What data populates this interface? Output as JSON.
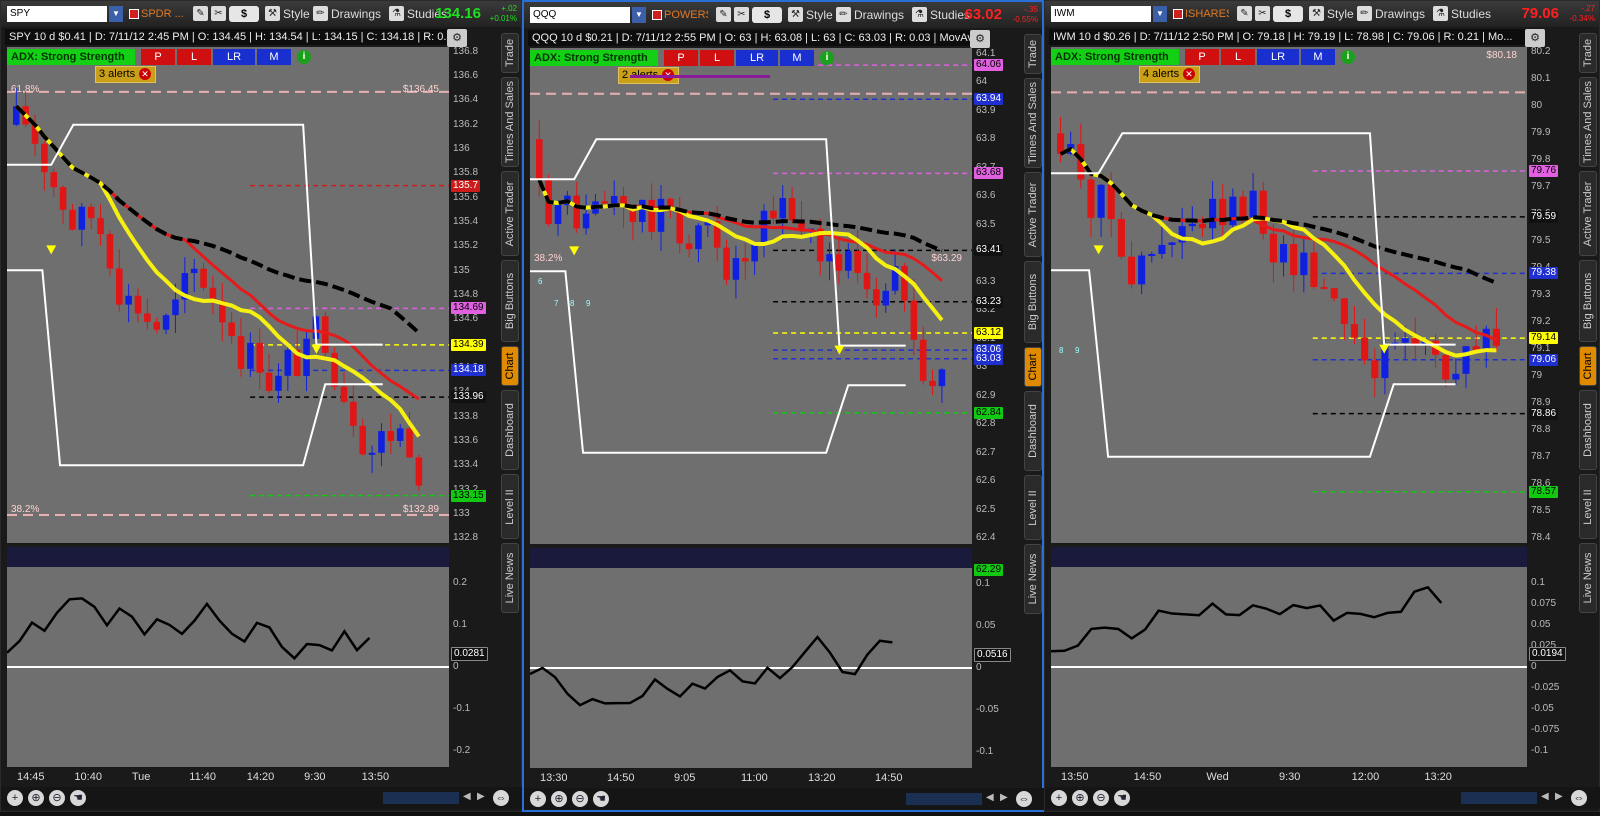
{
  "panels": [
    {
      "id": "spy",
      "symbol": "SPY",
      "description": "SPDR ...",
      "last": "134.16",
      "last_color": "#1fe01f",
      "change_top": "+.02",
      "change_bottom": "+0.01%",
      "change_color": "#1fe01f",
      "info": "SPY 10 d $0.41 | D: 7/11/12 2:45 PM | O: 134.45 | H: 134.54 | L: 134.15 | C: 134.18 | R: 0.39",
      "adx": "ADX: Strong Strength",
      "alerts": "3 alerts",
      "fib_top": "61.8%",
      "fib_bottom": "38.2%",
      "level_top": "$136.45",
      "level_bottom": "$132.89",
      "price_axis": [
        "136.8",
        "136.6",
        "136.4",
        "136.2",
        "136",
        "135.8",
        "135.6",
        "135.4",
        "135.2",
        "135",
        "134.8",
        "134.6",
        "134.4",
        "134.2",
        "134",
        "133.8",
        "133.6",
        "133.4",
        "133.2",
        "133",
        "132.8"
      ],
      "badges": [
        {
          "text": "135.7",
          "bg": "#cc1b1b",
          "fg": "#fff",
          "value": 135.7
        },
        {
          "text": "134.69",
          "bg": "#e060e0",
          "fg": "#000",
          "value": 134.69
        },
        {
          "text": "134.39",
          "bg": "#ffff00",
          "fg": "#000",
          "value": 134.39
        },
        {
          "text": "134.18",
          "bg": "#2030d0",
          "fg": "#fff",
          "value": 134.18
        },
        {
          "text": "133.96",
          "bg": "#111",
          "fg": "#fff",
          "value": 133.96
        },
        {
          "text": "133.15",
          "bg": "#12c912",
          "fg": "#000",
          "value": 133.15
        }
      ],
      "osc_axis": [
        "0.2",
        "0.1",
        "0",
        "-0.1",
        "-0.2"
      ],
      "osc_badge": "0.0281",
      "times": [
        "14:45",
        "10:40",
        "Tue",
        "11:40",
        "14:20",
        "9:30",
        "13:50"
      ],
      "marks": []
    },
    {
      "id": "qqq",
      "symbol": "QQQ",
      "description": "POWERS...",
      "last": "63.02",
      "last_color": "#ff2020",
      "change_top": "-.35",
      "change_bottom": "-0.55%",
      "change_color": "#ff2020",
      "info": "QQQ 10 d $0.21 | D: 7/11/12 2:55 PM | O: 63 | H: 63.08 | L: 63 | C: 63.03 | R: 0.03 | MovAvgE...",
      "adx": "ADX: Strong Strength",
      "alerts": "2 alerts",
      "fib_top": "38.2%",
      "fib_bottom": "",
      "level_top": "$63.29",
      "level_bottom": "",
      "price_axis": [
        "64.1",
        "64",
        "63.9",
        "63.8",
        "63.7",
        "63.6",
        "63.5",
        "63.4",
        "63.3",
        "63.2",
        "63.1",
        "63",
        "62.9",
        "62.8",
        "62.7",
        "62.6",
        "62.5",
        "62.4"
      ],
      "badges": [
        {
          "text": "64.06",
          "bg": "#e060e0",
          "fg": "#000",
          "value": 64.06
        },
        {
          "text": "63.94",
          "bg": "#2030d0",
          "fg": "#fff",
          "value": 63.94
        },
        {
          "text": "63.68",
          "bg": "#e060e0",
          "fg": "#000",
          "value": 63.68
        },
        {
          "text": "63.41",
          "bg": "#111",
          "fg": "#fff",
          "value": 63.41
        },
        {
          "text": "63.23",
          "bg": "#111",
          "fg": "#fff",
          "value": 63.23
        },
        {
          "text": "63.12",
          "bg": "#ffff00",
          "fg": "#000",
          "value": 63.12
        },
        {
          "text": "63.06",
          "bg": "#2030d0",
          "fg": "#fff",
          "value": 63.06
        },
        {
          "text": "63.03",
          "bg": "#2030d0",
          "fg": "#fff",
          "value": 63.03
        },
        {
          "text": "62.84",
          "bg": "#12c912",
          "fg": "#000",
          "value": 62.84
        },
        {
          "text": "62.29",
          "bg": "#12c912",
          "fg": "#000",
          "value": 62.29
        }
      ],
      "osc_axis": [
        "0.1",
        "0.05",
        "0",
        "-0.05",
        "-0.1"
      ],
      "osc_badge": "0.0516",
      "times": [
        "13:30",
        "14:50",
        "9:05",
        "11:00",
        "13:20",
        "14:50"
      ],
      "marks": [
        "6",
        "7",
        "8",
        "9"
      ]
    },
    {
      "id": "iwm",
      "symbol": "IWM",
      "description": "ISHARES...",
      "last": "79.06",
      "last_color": "#ff2020",
      "change_top": "-.27",
      "change_bottom": "-0.34%",
      "change_color": "#ff2020",
      "info": "IWM 10 d $0.26 | D: 7/11/12 2:50 PM | O: 79.18 | H: 79.19 | L: 78.98 | C: 79.06 | R: 0.21 | Mo...",
      "adx": "ADX: Strong Strength",
      "alerts": "4 alerts",
      "fib_top": "",
      "fib_bottom": "",
      "level_top": "$80.18",
      "level_bottom": "",
      "price_axis": [
        "80.2",
        "80.1",
        "80",
        "79.9",
        "79.8",
        "79.7",
        "79.6",
        "79.5",
        "79.4",
        "79.3",
        "79.2",
        "79.1",
        "79",
        "78.9",
        "78.8",
        "78.7",
        "78.6",
        "78.5",
        "78.4"
      ],
      "badges": [
        {
          "text": "79.76",
          "bg": "#e060e0",
          "fg": "#000",
          "value": 79.76
        },
        {
          "text": "79.59",
          "bg": "#111",
          "fg": "#fff",
          "value": 79.59
        },
        {
          "text": "79.38",
          "bg": "#2030d0",
          "fg": "#fff",
          "value": 79.38
        },
        {
          "text": "79.14",
          "bg": "#ffff00",
          "fg": "#000",
          "value": 79.14
        },
        {
          "text": "79.06",
          "bg": "#2030d0",
          "fg": "#fff",
          "value": 79.06
        },
        {
          "text": "78.86",
          "bg": "#111",
          "fg": "#fff",
          "value": 78.86
        },
        {
          "text": "78.57",
          "bg": "#12c912",
          "fg": "#000",
          "value": 78.57
        }
      ],
      "osc_axis": [
        "0.1",
        "0.075",
        "0.05",
        "0.025",
        "0",
        "-0.025",
        "-0.05",
        "-0.075",
        "-0.1"
      ],
      "osc_badge": "0.0194",
      "times": [
        "13:50",
        "14:50",
        "Wed",
        "9:30",
        "12:00",
        "13:20"
      ],
      "marks": [
        "8",
        "9"
      ]
    }
  ],
  "toolbar": {
    "style": "Style",
    "drawings": "Drawings",
    "studies": "Studies",
    "dollar": "$"
  },
  "chart_buttons": [
    "P",
    "L",
    "LR",
    "M"
  ],
  "side_tabs": [
    "Trade",
    "Times And Sales",
    "Active Trader",
    "Big Buttons",
    "Chart",
    "Dashboard",
    "Level II",
    "Live News"
  ]
}
